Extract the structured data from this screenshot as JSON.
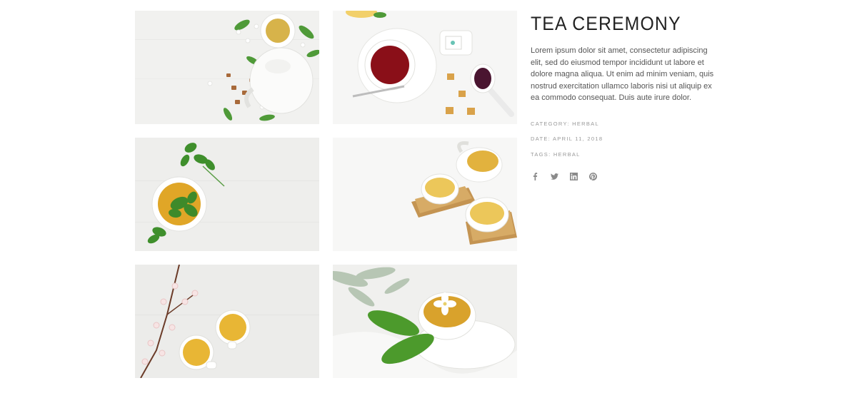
{
  "project": {
    "title": "TEA CEREMONY",
    "description": "Lorem ipsum dolor sit amet, consectetur adipiscing elit, sed do eiusmod tempor incididunt ut labore et dolore magna aliqua. Ut enim ad minim veniam, quis nostrud exercitation ullamco laboris nisi ut aliquip ex ea commodo consequat. Duis aute irure dolor.",
    "meta": {
      "category": "CATEGORY: HERBAL",
      "date": "DATE: APRIL 11, 2018",
      "tags": "TAGS: HERBAL"
    }
  },
  "social": [
    "facebook-icon",
    "twitter-icon",
    "linkedin-icon",
    "pinterest-icon"
  ],
  "colors": {
    "tea": "#d9a52a",
    "red_tea": "#8a0f18",
    "leaf": "#3f8f2c",
    "wood": "#b88a4a",
    "icon": "#8a8a8a"
  }
}
